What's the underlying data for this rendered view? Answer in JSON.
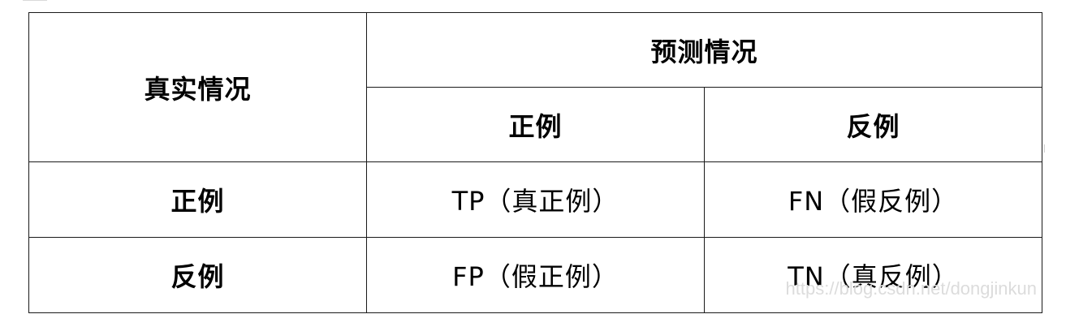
{
  "caption_fragment": "",
  "table": {
    "actual_header": "真实情况",
    "predicted_header": "预测情况",
    "predicted_columns": [
      "正例",
      "反例"
    ],
    "rows": [
      {
        "label": "正例",
        "cells": [
          "TP（真正例）",
          "FN（假反例）"
        ]
      },
      {
        "label": "反例",
        "cells": [
          "FP（假正例）",
          "TN（真反例）"
        ]
      }
    ]
  },
  "watermark": "https://blog.csdn.net/dongjinkun"
}
